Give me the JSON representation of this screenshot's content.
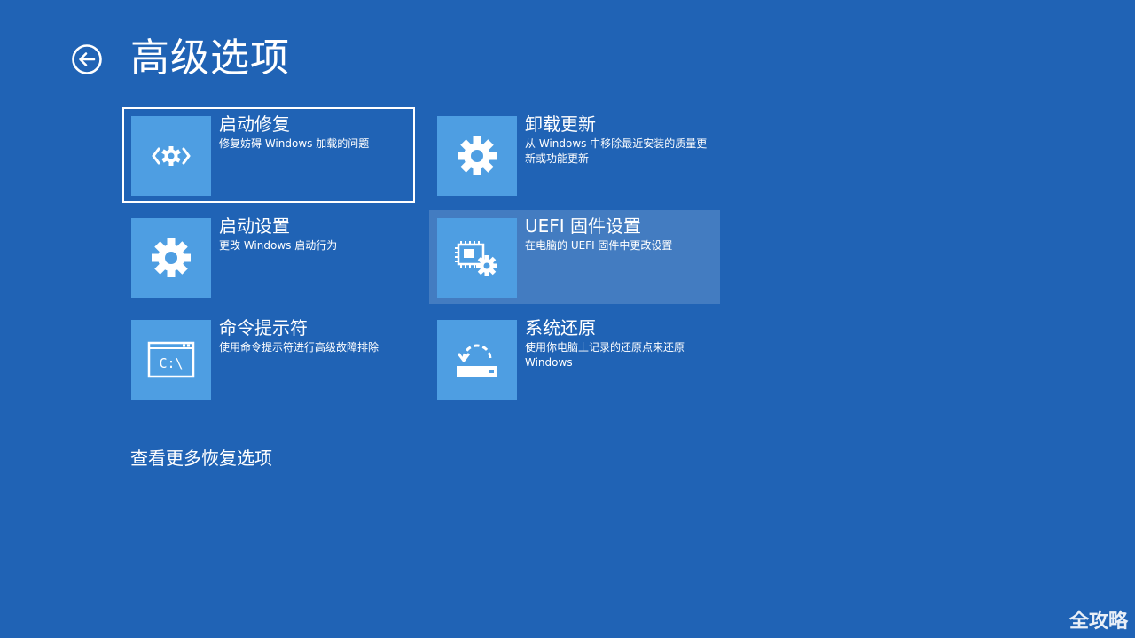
{
  "header": {
    "title": "高级选项"
  },
  "options": [
    {
      "title": "启动修复",
      "description": "修复妨碍 Windows 加载的问题",
      "icon": "startup-repair-icon"
    },
    {
      "title": "卸载更新",
      "description": "从 Windows 中移除最近安装的质量更新或功能更新",
      "icon": "gear-icon"
    },
    {
      "title": "启动设置",
      "description": "更改 Windows 启动行为",
      "icon": "gear-icon"
    },
    {
      "title": "UEFI 固件设置",
      "description": "在电脑的 UEFI 固件中更改设置",
      "icon": "firmware-chip-icon"
    },
    {
      "title": "命令提示符",
      "description": "使用命令提示符进行高级故障排除",
      "icon": "command-prompt-icon",
      "icon_text": "C:\\"
    },
    {
      "title": "系统还原",
      "description": "使用你电脑上记录的还原点来还原 Windows",
      "icon": "system-restore-icon"
    }
  ],
  "footer": {
    "more_options": "查看更多恢复选项"
  },
  "watermark": "全攻略",
  "colors": {
    "background": "#2063b5",
    "tile_icon": "#4e9ee2"
  }
}
